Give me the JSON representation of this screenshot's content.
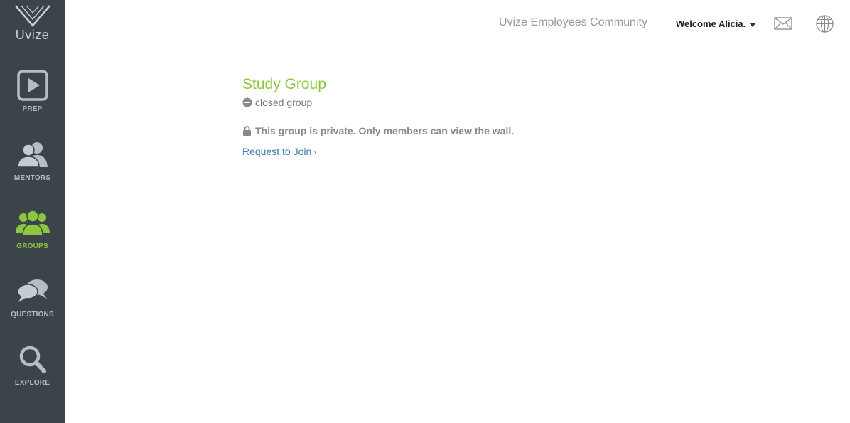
{
  "sidebar": {
    "logo_text": "Uvize",
    "items": [
      {
        "label": "PREP",
        "icon": "play-icon",
        "active": false
      },
      {
        "label": "MENTORS",
        "icon": "mentors-icon",
        "active": false
      },
      {
        "label": "GROUPS",
        "icon": "groups-icon",
        "active": true
      },
      {
        "label": "QUESTIONS",
        "icon": "chat-bubbles-icon",
        "active": false
      },
      {
        "label": "EXPLORE",
        "icon": "search-icon",
        "active": false
      }
    ]
  },
  "header": {
    "community": "Uvize Employees Community",
    "welcome": "Welcome Alicia.",
    "icons": [
      "envelope-icon",
      "globe-icon"
    ]
  },
  "group": {
    "title": "Study Group",
    "status": "closed group",
    "private_notice": "This group is private. Only members can view the wall.",
    "join_label": "Request to Join",
    "join_arrow": "›"
  },
  "colors": {
    "sidebar_bg": "#3b4449",
    "accent_green": "#8cc63f",
    "link_blue": "#3a7cb3",
    "nav_label": "#b7bec3"
  }
}
